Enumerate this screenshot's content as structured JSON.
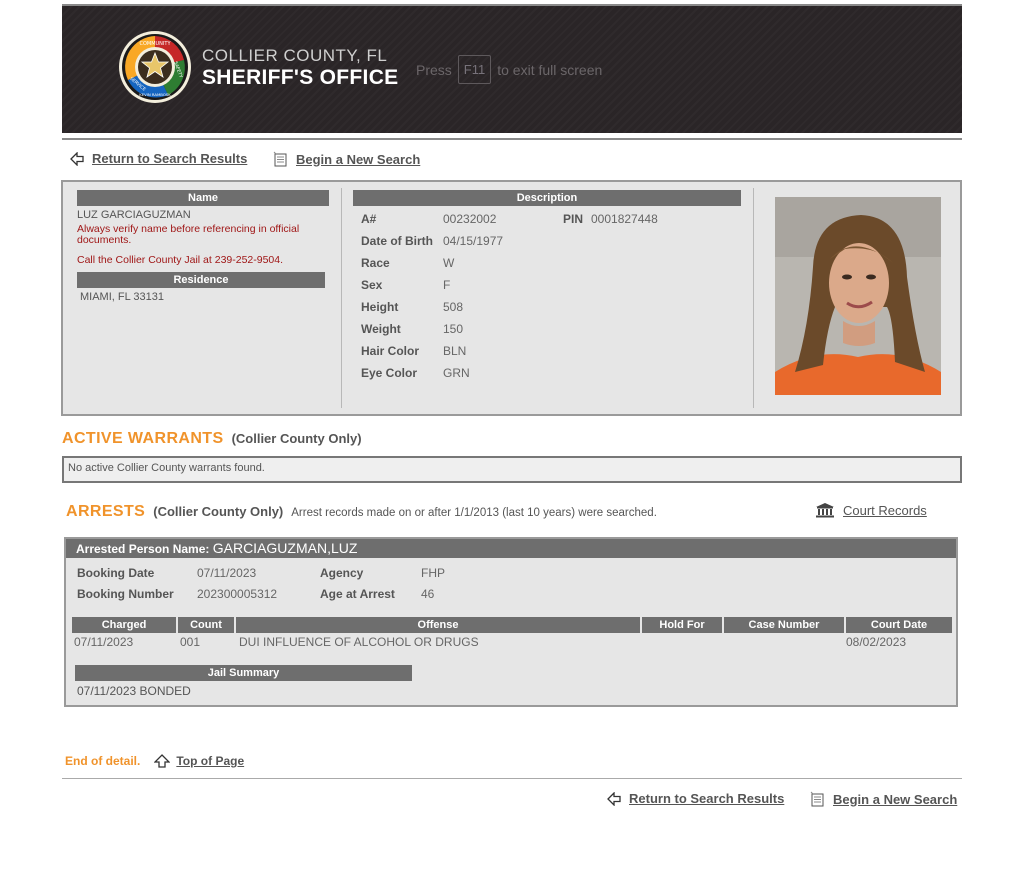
{
  "header": {
    "agency_line1": "COLLIER COUNTY, FL",
    "agency_line2": "SHERIFF'S OFFICE",
    "fullscreen_press": "Press",
    "fullscreen_key": "F11",
    "fullscreen_rest": "to exit full screen",
    "seal_text_top": "COMMUNITY",
    "seal_text_right": "SAFETY",
    "seal_text_left": "SERVICE",
    "seal_text_bottom": "KEVIN RAMBOSK"
  },
  "nav": {
    "return_label": "Return to Search Results",
    "new_search_label": "Begin a New Search"
  },
  "person": {
    "name_header": "Name",
    "name": "LUZ GARCIAGUZMAN",
    "verify_warning": "Always verify name before referencing in official documents.",
    "call_notice": "Call the Collier County Jail at 239-252-9504.",
    "residence_header": "Residence",
    "residence": "MIAMI, FL 33131",
    "description_header": "Description",
    "a_label": "A#",
    "a_value": "00232002",
    "pin_label": "PIN",
    "pin_value": "0001827448",
    "fields": [
      {
        "label": "Date of Birth",
        "value": "04/15/1977"
      },
      {
        "label": "Race",
        "value": "W"
      },
      {
        "label": "Sex",
        "value": "F"
      },
      {
        "label": "Height",
        "value": "508"
      },
      {
        "label": "Weight",
        "value": "150"
      },
      {
        "label": "Hair Color",
        "value": "BLN"
      },
      {
        "label": "Eye Color",
        "value": "GRN"
      }
    ]
  },
  "warrants": {
    "title": "ACTIVE WARRANTS",
    "scope": "(Collier County Only)",
    "message": "No active Collier County warrants found."
  },
  "arrests": {
    "title": "ARRESTS",
    "scope": "(Collier County Only)",
    "note": "Arrest records made on or after 1/1/2013 (last 10 years) were searched.",
    "court_records_label": "Court Records",
    "person_label": "Arrested Person Name:",
    "person_name": "GARCIAGUZMAN,LUZ",
    "booking_date_label": "Booking Date",
    "booking_date": "07/11/2023",
    "booking_number_label": "Booking Number",
    "booking_number": "202300005312",
    "agency_label": "Agency",
    "agency": "FHP",
    "age_label": "Age at Arrest",
    "age": "46",
    "columns": [
      "Charged",
      "Count",
      "Offense",
      "Hold For",
      "Case Number",
      "Court Date"
    ],
    "charge": {
      "charged": "07/11/2023",
      "count": "001",
      "offense": "DUI INFLUENCE OF ALCOHOL OR DRUGS",
      "hold_for": "",
      "case_number": "",
      "court_date": "08/02/2023"
    },
    "jail_summary_header": "Jail Summary",
    "jail_summary": "07/11/2023 BONDED"
  },
  "footer": {
    "end_label": "End of detail.",
    "top_label": "Top of Page"
  },
  "colors": {
    "accent_orange": "#f0932b",
    "header_bg": "#2a2527",
    "bar_gray": "#6e6e6e",
    "warning_red": "#a01818"
  }
}
